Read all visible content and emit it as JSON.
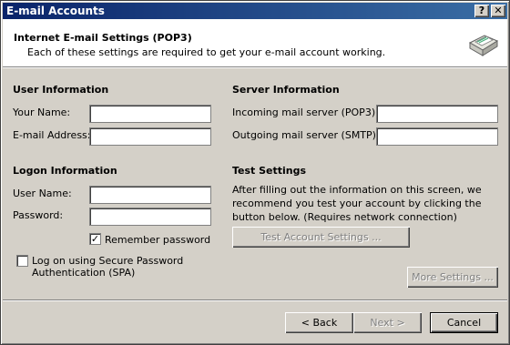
{
  "window": {
    "title": "E-mail Accounts",
    "help_glyph": "?",
    "close_glyph": "✕"
  },
  "header": {
    "title": "Internet E-mail Settings (POP3)",
    "subtitle": "Each of these settings are required to get your e-mail account working.",
    "icon": "email-envelope-icon"
  },
  "user_info": {
    "heading": "User Information",
    "name_label": "Your Name:",
    "name_value": "",
    "email_label": "E-mail Address:",
    "email_value": ""
  },
  "server_info": {
    "heading": "Server Information",
    "incoming_label": "Incoming mail server (POP3):",
    "incoming_value": "",
    "outgoing_label": "Outgoing mail server (SMTP):",
    "outgoing_value": ""
  },
  "logon_info": {
    "heading": "Logon Information",
    "username_label": "User Name:",
    "username_value": "",
    "password_label": "Password:",
    "password_value": "",
    "remember_label": "Remember password",
    "remember_checked": true,
    "spa_label_line1": "Log on using Secure Password",
    "spa_label_line2": "Authentication (SPA)",
    "spa_checked": false
  },
  "test_settings": {
    "heading": "Test Settings",
    "description": "After filling out the information on this screen, we recommend you test your account by clicking the button below. (Requires network connection)",
    "button_label": "Test Account Settings ..."
  },
  "more_settings_label": "More Settings ...",
  "footer": {
    "back_label": "< Back",
    "next_label": "Next >",
    "cancel_label": "Cancel"
  },
  "check_glyph": "✓"
}
